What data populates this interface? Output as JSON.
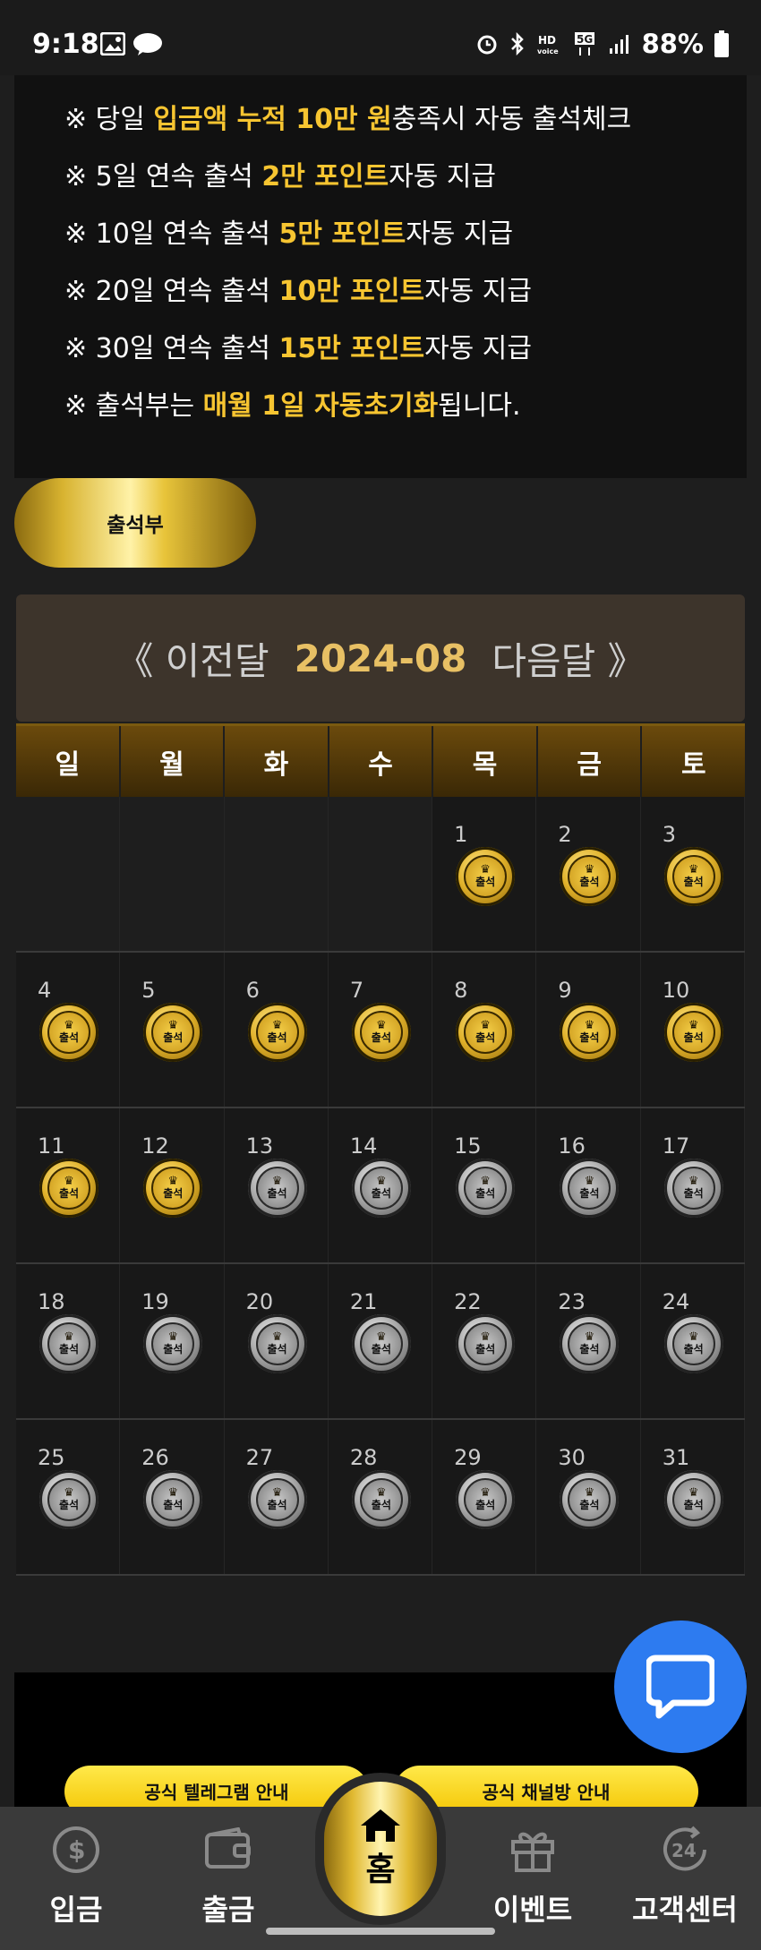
{
  "status_bar": {
    "time": "9:18",
    "battery": "88%"
  },
  "notice": {
    "lines": [
      {
        "prefix": "※ 당일 ",
        "highlight": "입금액 누적 10만 원",
        "suffix": "충족시 자동 출석체크"
      },
      {
        "prefix": "※ 5일 연속 출석 ",
        "highlight": "2만 포인트",
        "suffix": "자동 지급"
      },
      {
        "prefix": "※ 10일 연속 출석 ",
        "highlight": "5만 포인트",
        "suffix": "자동 지급"
      },
      {
        "prefix": "※ 20일 연속 출석 ",
        "highlight": "10만 포인트",
        "suffix": "자동 지급"
      },
      {
        "prefix": "※ 30일 연속 출석 ",
        "highlight": "15만 포인트",
        "suffix": "자동 지급"
      },
      {
        "prefix": "※ 출석부는 ",
        "highlight": "매월 1일 자동초기화",
        "suffix": "됩니다."
      }
    ]
  },
  "attendance_button": "출석부",
  "calendar": {
    "prev_label": "《 이전달",
    "year_month": "2024-08",
    "next_label": "다음달 》",
    "weekdays": [
      "일",
      "월",
      "화",
      "수",
      "목",
      "금",
      "토"
    ],
    "coin_label": "출석",
    "first_weekday": 4,
    "days_in_month": 31,
    "attended_through": 12
  },
  "pills": {
    "telegram": "공식 텔레그램 안내",
    "channel": "공식 채널방 안내"
  },
  "nav": {
    "deposit": "입금",
    "withdraw": "출금",
    "home": "홈",
    "event": "이벤트",
    "support": "고객센터"
  },
  "colors": {
    "gold": "#f7c531",
    "chat_blue": "#2d7bf0"
  }
}
